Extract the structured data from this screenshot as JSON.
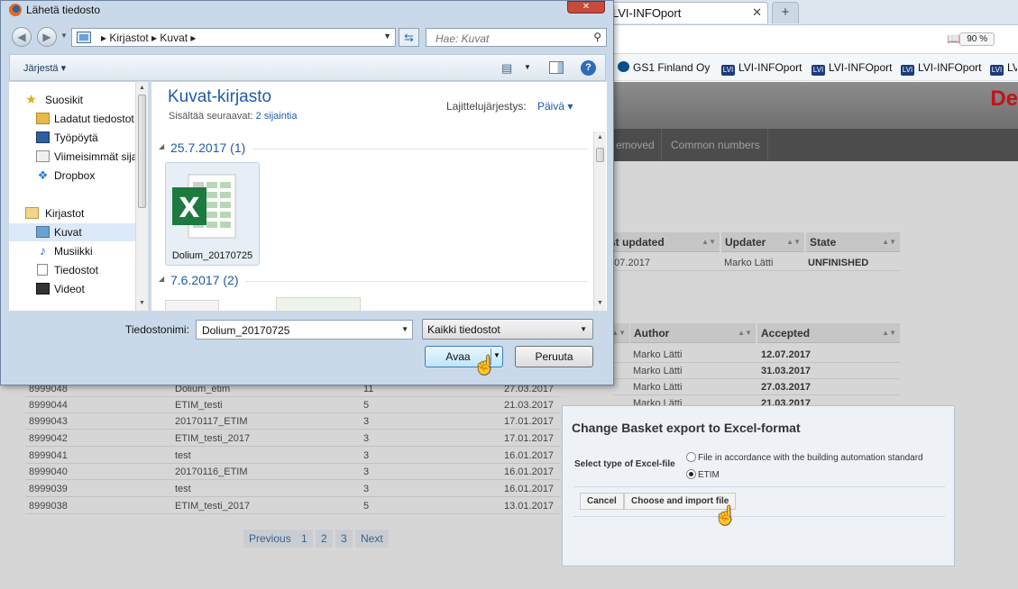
{
  "browser": {
    "tabs": [
      {
        "label": "LVI-INFOport",
        "active": true
      },
      {
        "label": "+"
      }
    ],
    "zoom": "90 %",
    "bookmarks": [
      {
        "label": "GS1 Finland Oy"
      },
      {
        "label": "LVI-INFOport"
      },
      {
        "label": "LVI-INFOport"
      },
      {
        "label": "LVI-INFOport"
      },
      {
        "label": "LVI-INFOport"
      }
    ]
  },
  "page": {
    "brand_partial": "De",
    "nav": [
      {
        "label": "emoved"
      },
      {
        "label": "Common numbers"
      }
    ],
    "upper_table": {
      "headers": [
        "st updated",
        "Updater",
        "State"
      ],
      "row": [
        "3.07.2017",
        "Marko Lätti",
        "UNFINISHED"
      ]
    },
    "lower_table": {
      "headers": [
        "Author",
        "Accepted"
      ],
      "right_rows": [
        [
          "Marko Lätti",
          "12.07.2017"
        ],
        [
          "Marko Lätti",
          "31.03.2017"
        ],
        [
          "Marko Lätti",
          "27.03.2017"
        ],
        [
          "Marko Lätti",
          "21.03.2017"
        ]
      ],
      "rows": [
        [
          "8999048",
          "Dolium_etim",
          "11",
          "27.03.2017"
        ],
        [
          "8999044",
          "ETIM_testi",
          "5",
          "21.03.2017"
        ],
        [
          "8999043",
          "20170117_ETIM",
          "3",
          "17.01.2017"
        ],
        [
          "8999042",
          "ETIM_testi_2017",
          "3",
          "17.01.2017"
        ],
        [
          "8999041",
          "test",
          "3",
          "16.01.2017"
        ],
        [
          "8999040",
          "20170116_ETIM",
          "3",
          "16.01.2017"
        ],
        [
          "8999039",
          "test",
          "3",
          "16.01.2017"
        ],
        [
          "8999038",
          "ETIM_testi_2017",
          "5",
          "13.01.2017"
        ]
      ]
    },
    "pager": [
      "Previous",
      "1",
      "2",
      "3",
      "Next"
    ]
  },
  "modal": {
    "title": "Change Basket export to Excel-format",
    "select_label": "Select type of Excel-file",
    "options": [
      {
        "label": "File in accordance with the building automation standard",
        "selected": false
      },
      {
        "label": "ETIM",
        "selected": true
      }
    ],
    "cancel_label": "Cancel",
    "import_label": "Choose and import file"
  },
  "dialog": {
    "title": "Lähetä tiedosto",
    "path": "▸  Kirjastot  ▸  Kuvat  ▸",
    "search_placeholder": "Hae: Kuvat",
    "organize_label": "Järjestä ▾",
    "nav": {
      "favorites_header": "Suosikit",
      "favorites": [
        "Ladatut tiedostot",
        "Työpöytä",
        "Viimeisimmät sijainnit",
        "Dropbox"
      ],
      "libraries_header": "Kirjastot",
      "libraries": [
        "Kuvat",
        "Musiikki",
        "Tiedostot",
        "Videot"
      ]
    },
    "library_title": "Kuvat-kirjasto",
    "library_subtitle_prefix": "Sisältää seuraavat:",
    "library_subtitle_link": "2 sijaintia",
    "sort_label": "Lajittelujärjestys:",
    "sort_value": "Päivä ▾",
    "groups": [
      {
        "label": "25.7.2017 (1)"
      },
      {
        "label": "7.6.2017 (2)"
      }
    ],
    "file_name_tile": "Dolium_20170725",
    "filename_label": "Tiedostonimi:",
    "filename_value": "Dolium_20170725",
    "filetype_value": "Kaikki tiedostot",
    "open_label": "Avaa",
    "cancel_label": "Peruuta"
  },
  "colors": {
    "link_blue": "#1e5aa8",
    "brand_red": "#c0141a",
    "excel_green": "#1d7a3f"
  }
}
